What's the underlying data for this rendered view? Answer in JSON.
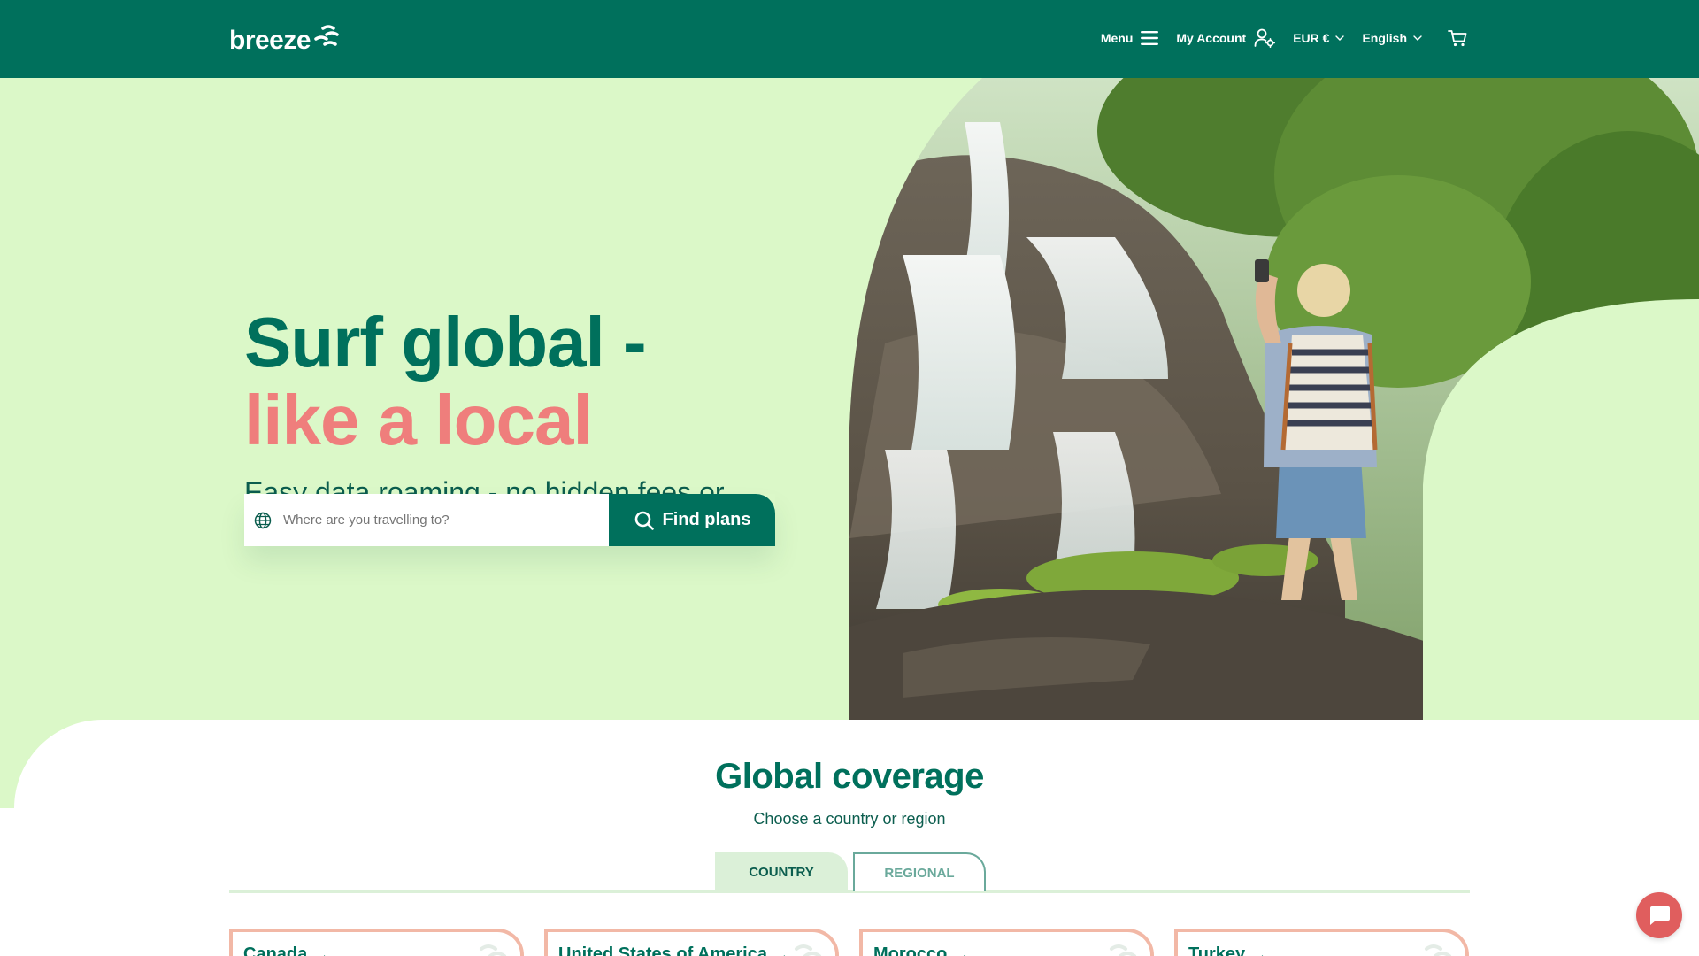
{
  "brand": {
    "name": "breeze"
  },
  "nav": {
    "menu_label": "Menu",
    "account_label": "My Account",
    "currency_label": "EUR €",
    "language_label": "English"
  },
  "hero": {
    "title_line1": "Surf global -",
    "title_line2": "like a local",
    "subtitle": "Easy data roaming - no hidden fees or surprises",
    "search_placeholder": "Where are you travelling to?",
    "search_value": "",
    "find_button_label": "Find plans"
  },
  "coverage": {
    "title": "Global coverage",
    "subtitle": "Choose a country or region",
    "tabs": [
      {
        "label": "COUNTRY",
        "active": true
      },
      {
        "label": "REGIONAL",
        "active": false
      }
    ],
    "cards": [
      {
        "label": "Canada"
      },
      {
        "label": "United States of America"
      },
      {
        "label": "Morocco"
      },
      {
        "label": "Turkey"
      }
    ]
  },
  "icons": {
    "logo": "breeze-wave-icon",
    "menu": "hamburger-icon",
    "account": "user-gear-icon",
    "currency": "chevron-down-icon",
    "language": "chevron-down-icon",
    "cart": "cart-icon",
    "search_field": "globe-icon",
    "find": "search-icon",
    "card": "arrow-right-icon",
    "chat": "chat-bubble-icon"
  },
  "colors": {
    "brand_green": "#00705c",
    "hero_background": "#dbf8c8",
    "accent_coral": "#ef7e7c",
    "card_border": "#f2b8a6",
    "chat_button": "#e05e5e"
  }
}
